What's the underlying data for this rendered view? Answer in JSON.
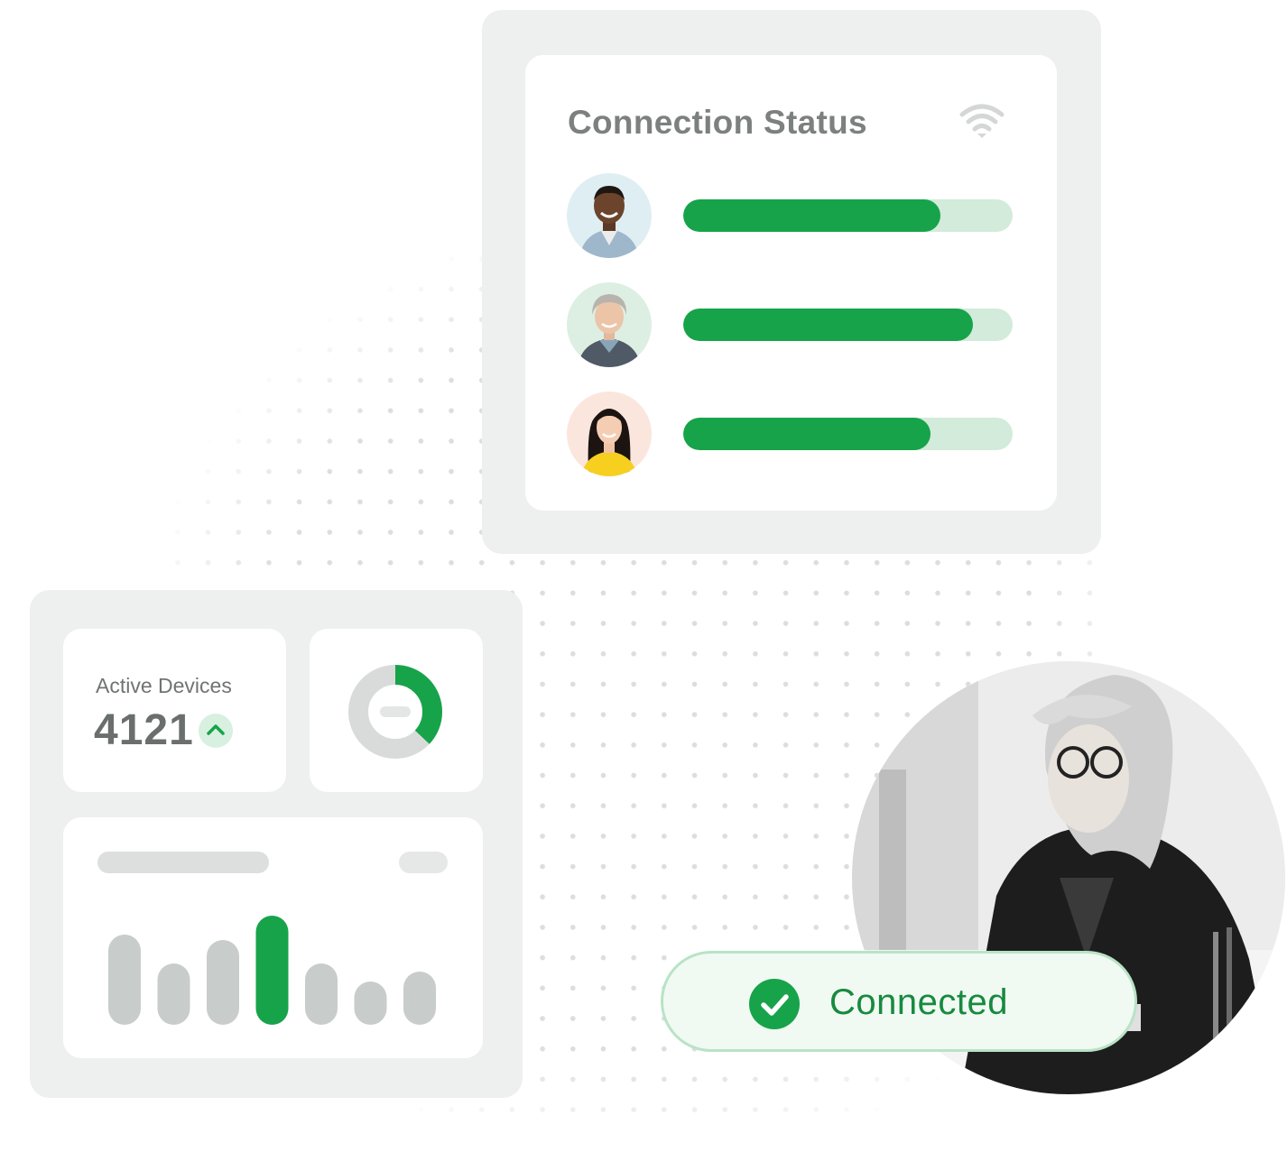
{
  "connection_status": {
    "title": "Connection Status",
    "icon": "wifi-icon",
    "rows": [
      {
        "avatar": "avatar-man-smiling",
        "progress": 0.78
      },
      {
        "avatar": "avatar-older-woman",
        "progress": 0.88
      },
      {
        "avatar": "avatar-young-woman",
        "progress": 0.75
      }
    ],
    "colors": {
      "fill": "#17a34a",
      "track": "#d2ebda"
    }
  },
  "dashboard": {
    "active_devices": {
      "label": "Active Devices",
      "value": "4121",
      "trend_icon": "chevron-up-icon"
    },
    "donut": {
      "fraction": 0.37,
      "colors": {
        "filled": "#17a34a",
        "rest": "#d8dbda"
      }
    },
    "bar_chart": {
      "values": [
        100,
        68,
        94,
        121,
        68,
        48,
        59
      ],
      "highlight_index": 3,
      "colors": {
        "normal": "#c8cccb",
        "highlight": "#17a34a"
      }
    }
  },
  "connected_badge": {
    "label": "Connected",
    "icon": "check-circle-icon"
  },
  "photo": {
    "subject": "woman-working-at-desk-photo"
  }
}
